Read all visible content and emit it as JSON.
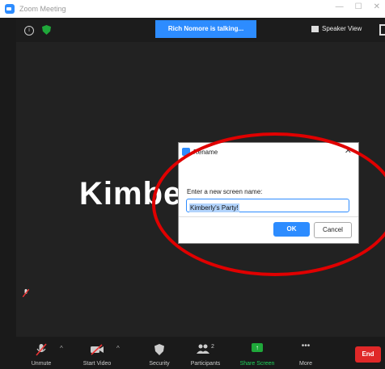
{
  "window": {
    "title": "Zoom Meeting"
  },
  "topbar": {
    "talking": "Rich Nomore is talking...",
    "speaker_view": "Speaker View"
  },
  "stage": {
    "participant_name": "Kimber"
  },
  "dialog": {
    "title": "Rename",
    "label": "Enter a new screen name:",
    "value": "Kimberly's Party!",
    "ok": "OK",
    "cancel": "Cancel"
  },
  "toolbar": {
    "unmute": "Unmute",
    "start_video": "Start Video",
    "security": "Security",
    "participants": "Participants",
    "participants_count": "2",
    "share_screen": "Share Screen",
    "more": "More",
    "end": "End"
  },
  "colors": {
    "zoom_blue": "#2d8cff",
    "end_red": "#e02828",
    "share_green": "#1fa83a",
    "highlight_red": "#e00000"
  }
}
